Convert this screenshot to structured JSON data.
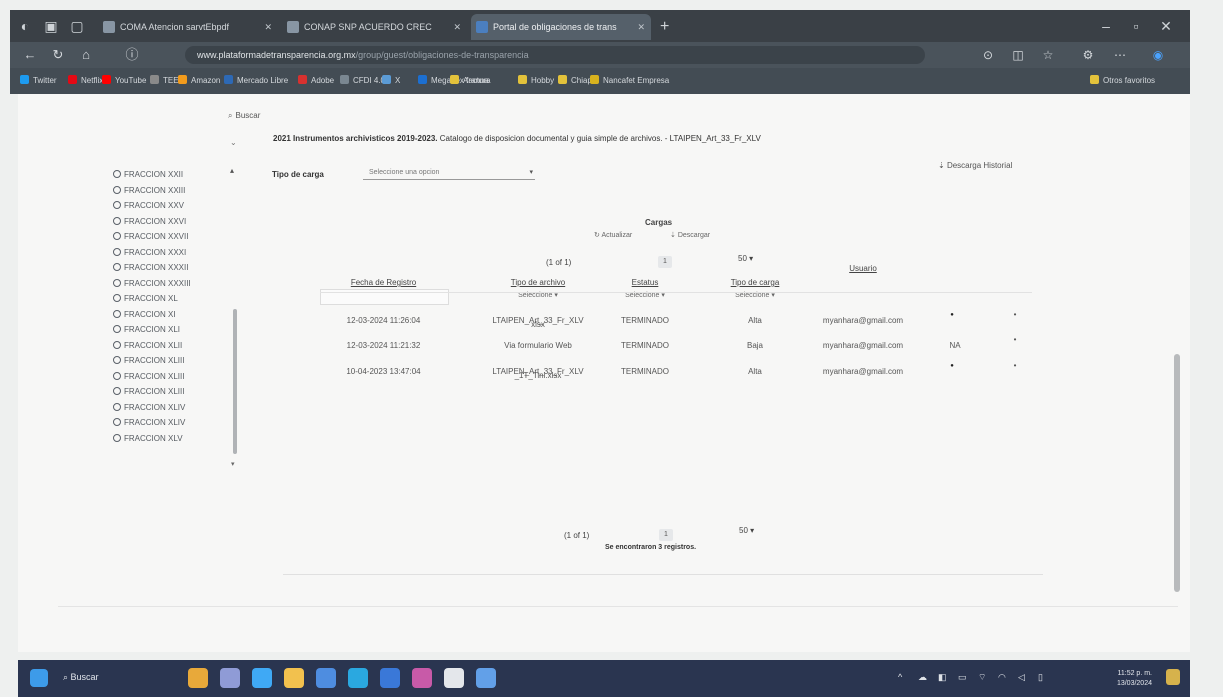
{
  "browser": {
    "tabs": [
      {
        "label": "COMA Atencion sarvtEbpdf"
      },
      {
        "label": "CONAP SNP ACUERDO CREC"
      },
      {
        "label": "Portal de obligaciones de trans"
      }
    ],
    "url_host": "www.plataformadetransparencia.org.mx",
    "url_rest": "/group/guest/obligaciones-de-transparencia",
    "bookmarks": [
      "Twitter",
      "Netflix",
      "YouTube",
      "TEEN",
      "Amazon",
      "Mercado Libre",
      "Adobe",
      "CFDI 4.0",
      "X",
      "Megadex factura",
      "Aranna",
      "Hobby",
      "Chiapa",
      "Nancafet Empresa"
    ],
    "other_bookmarks": "Otros favoritos"
  },
  "page": {
    "search_label": "Buscar",
    "doc_title_bold": "2021 Instrumentos archivisticos 2019-2023.",
    "doc_title_rest": "Catalogo de disposicion documental y guia simple de archivos. - LTAIPEN_Art_33_Fr_XLV",
    "tipo_label": "Tipo de carga",
    "tipo_select_placeholder": "Seleccione una opcion",
    "descarga_historial": "Descarga Historial",
    "sidebar_items": [
      "FRACCION XXII",
      "FRACCION XXIII",
      "FRACCION XXV",
      "FRACCION XXVI",
      "FRACCION XXVII",
      "FRACCION XXXI",
      "FRACCION XXXII",
      "FRACCION XXXIII",
      "FRACCION XL",
      "FRACCION XI",
      "FRACCION XLI",
      "FRACCION XLII",
      "FRACCION XLIII",
      "FRACCION XLIII",
      "FRACCION XLIII",
      "FRACCION XLIV",
      "FRACCION XLIV",
      "FRACCION XLV"
    ],
    "cargas": {
      "title": "Cargas",
      "actualizar": "Actualizar",
      "descargar": "Descargar",
      "pager": "(1 of 1)",
      "page_num": "1",
      "rows_per_page": "50",
      "columns": [
        "Fecha de Registro",
        "Tipo de archivo",
        "Estatus",
        "Tipo de carga",
        "Usuario"
      ],
      "filter_placeholder": "Seleccione",
      "rows": [
        {
          "fecha": "12-03-2024 11:26:04",
          "tipo_archivo": "LTAIPEN_Art_33_Fr_XLV",
          "tipo_archivo_2": "xlsx",
          "estatus": "TERMINADO",
          "tipo_carga": "Alta",
          "usuario": "myanhara@gmail.com",
          "extra": ""
        },
        {
          "fecha": "12-03-2024 11:21:32",
          "tipo_archivo": "Via formulario Web",
          "tipo_archivo_2": "",
          "estatus": "TERMINADO",
          "tipo_carga": "Baja",
          "usuario": "myanhara@gmail.com",
          "extra": "NA"
        },
        {
          "fecha": "10-04-2023 13:47:04",
          "tipo_archivo": "LTAIPEN_Art_33_Fr_XLV",
          "tipo_archivo_2": "_1T_Tini.xlsx",
          "estatus": "TERMINADO",
          "tipo_carga": "Alta",
          "usuario": "myanhara@gmail.com",
          "extra": ""
        }
      ],
      "footer_pager": "(1 of 1)",
      "footer_page_num": "1",
      "footer_rows_per_page": "50",
      "records_found": "Se encontraron 3 registros."
    }
  },
  "taskbar": {
    "search_label": "Buscar",
    "time": "11:52 p. m.",
    "date": "13/03/2024"
  },
  "colors": {
    "taskbar": "#2a3550",
    "browser_chrome": "#3a4046",
    "page_bg": "#f7f7f6"
  }
}
